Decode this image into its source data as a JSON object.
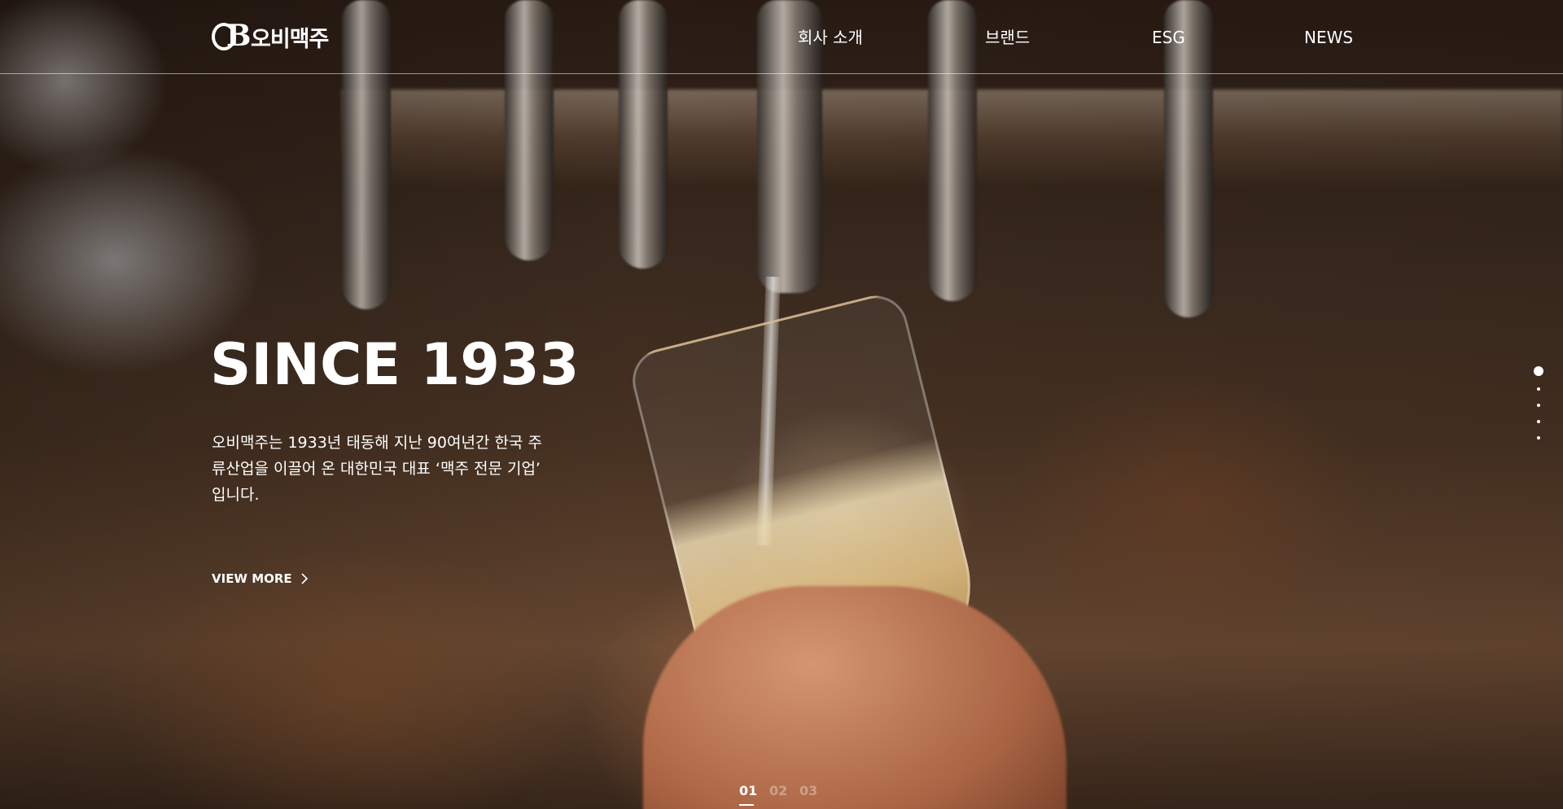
{
  "brand": {
    "logo_mark": "B",
    "logo_text": "오비맥주"
  },
  "nav": {
    "items": [
      {
        "label": "회사 소개"
      },
      {
        "label": "브랜드"
      },
      {
        "label": "ESG"
      },
      {
        "label": "NEWS"
      }
    ]
  },
  "hero": {
    "title": "SINCE 1933",
    "description": "오비맥주는 1933년 태동해 지난 90여년간 한국 주류산업을 이끌어 온 대한민국 대표 ‘맥주 전문 기업’ 입니다.",
    "view_more_label": "VIEW MORE"
  },
  "slider": {
    "vertical_dots_count": 5,
    "active_dot": 0,
    "pages": [
      "01",
      "02",
      "03"
    ],
    "active_page": "01"
  },
  "icons": {
    "view_more": "chevron-right-icon"
  },
  "colors": {
    "text": "#ffffff",
    "inactive_page": "rgba(255,255,255,0.35)"
  }
}
